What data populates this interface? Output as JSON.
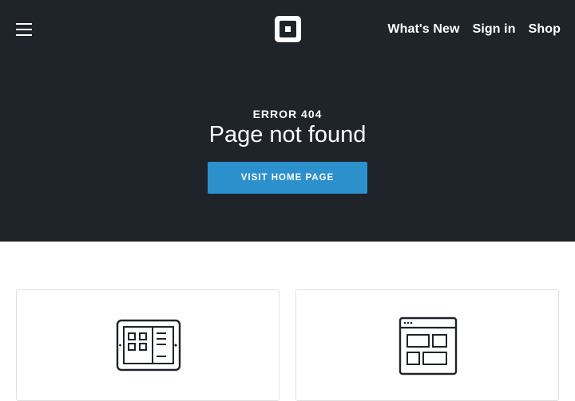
{
  "header": {
    "logo": "square-logo",
    "menu_icon": "hamburger-menu-icon",
    "nav_links": [
      {
        "label": "What's New"
      },
      {
        "label": "Sign in"
      },
      {
        "label": "Shop"
      }
    ]
  },
  "hero": {
    "error_code": "ERROR 404",
    "title": "Page not found",
    "button_label": "VISIT HOME PAGE"
  },
  "cards": [
    {
      "icon": "register-hardware-icon"
    },
    {
      "icon": "website-layout-icon"
    }
  ],
  "colors": {
    "hero_background": "#1f232a",
    "button_background": "#2b90cc",
    "card_border": "#e0e0e0"
  }
}
